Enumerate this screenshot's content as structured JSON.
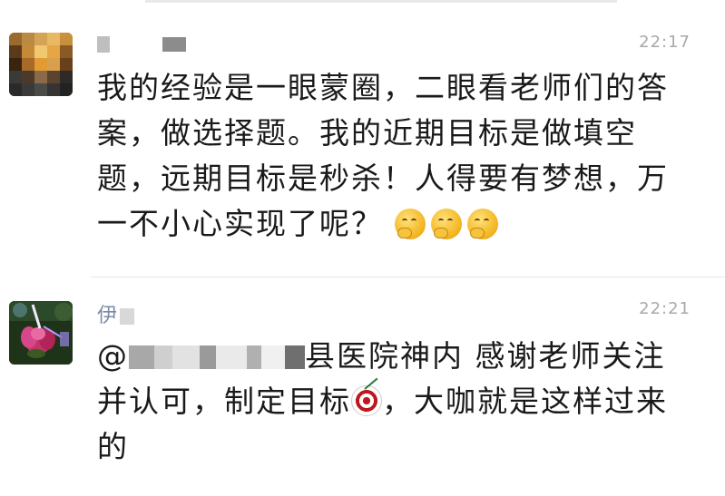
{
  "comments": [
    {
      "username_visible": "",
      "timestamp": "22:17",
      "text_main": "我的经验是一眼蒙圈，二眼看老师们的答案，做选择题。我的近期目标是做填空题，远期目标是秒杀！人得要有梦想，万一不小心实现了呢？",
      "emojis": [
        "thinking-face-emoji",
        "thinking-face-emoji",
        "thinking-face-emoji"
      ]
    },
    {
      "username_visible": "伊",
      "timestamp": "22:21",
      "mention_prefix": "@",
      "text_after_mention": "县医院神内 感谢老师关注并认可，制定目标",
      "text_after_emoji": "，大咖就是这样过来的",
      "emoji": "direct-hit-emoji"
    }
  ],
  "colors": {
    "username": "#7b8aa3",
    "timestamp": "#a9a9a9",
    "body_text": "#1a1a1a",
    "divider": "#e6e6e6"
  }
}
